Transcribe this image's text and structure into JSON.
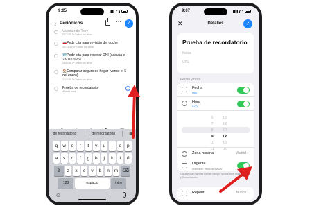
{
  "left_phone": {
    "status": {
      "time": "9:05"
    },
    "nav": {
      "back": "‹",
      "title": "Periódicos",
      "more": "···",
      "done": "✓"
    },
    "reminders": [
      {
        "title": "Vacunar de Toby",
        "subtitle": "27/7/25 ⟳ Todos los años",
        "faded": true,
        "emoji": ""
      },
      {
        "title": "Pedir cita para revisión del coche",
        "subtitle": "20/11/26 ⟳ Todos los años",
        "faded": false,
        "emoji": "🚗"
      },
      {
        "title": "Pedir cita para renovar DNI (caduca el 23/10/2026)",
        "subtitle": "24/6/26 ⟳ Todos los años",
        "faded": false,
        "emoji": "🪪"
      },
      {
        "title": "Comparar seguro de hogar (vence el 5 del enero)",
        "subtitle": "1/12/26 ⟳ Todos los años",
        "faded": false,
        "emoji": "🏠"
      },
      {
        "title": "Prueba de recordatorio",
        "subtitle": "Añadir nota",
        "faded": false,
        "emoji": "",
        "info": true
      }
    ],
    "toolbar": [
      "⊕",
      "⌖",
      "#",
      "⚑",
      "▣"
    ],
    "keyboard": {
      "suggestions": [
        "\"de recordatorio\"",
        "de recordatorio",
        "▦"
      ],
      "row1": [
        "q",
        "w",
        "e",
        "r",
        "t",
        "y",
        "u",
        "i",
        "o",
        "p"
      ],
      "row2": [
        "a",
        "s",
        "d",
        "f",
        "g",
        "h",
        "j",
        "k",
        "l",
        "ñ"
      ],
      "row3": [
        "⇧",
        "z",
        "x",
        "c",
        "v",
        "b",
        "n",
        "m",
        "⌫"
      ],
      "row4": {
        "num": "123",
        "space": "espacio",
        "return": "intro"
      },
      "emoji": "☺"
    }
  },
  "right_phone": {
    "status": {
      "time": "9:07"
    },
    "nav": {
      "close": "✕",
      "title": "Detalles",
      "done": "✓"
    },
    "reminder_title": "Prueba de recordatorio",
    "notes_placeholder": "Notas",
    "url_placeholder": "URL",
    "section_label": "Fecha y hora",
    "fecha": {
      "label": "Fecha",
      "value": "Hoy",
      "toggle": true
    },
    "hora": {
      "label": "Hora",
      "value": "9:00",
      "toggle": true
    },
    "picker": {
      "hours": [
        "6",
        "7",
        "8",
        "9",
        "10",
        "11"
      ],
      "minutes": [
        "05",
        "06",
        "07",
        "08",
        "09",
        "10"
      ],
      "selected_hour": "9",
      "selected_minute": "08"
    },
    "zona": {
      "label": "Zona horaria",
      "value": "Madrid ›"
    },
    "urgente": {
      "label": "Urgente",
      "subtitle": "Alarma en \"Hora de Avisos\"",
      "toggle": true
    },
    "footnote": "Las alarmas Urgentes suenan siempre ignorando el modo Silencio y Concentración.",
    "repetir": {
      "label": "Repetir",
      "value": "Nunca ›"
    }
  },
  "colors": {
    "accent": "#1c85ff",
    "toggle_on": "#34c759",
    "arrow": "#e02020"
  }
}
